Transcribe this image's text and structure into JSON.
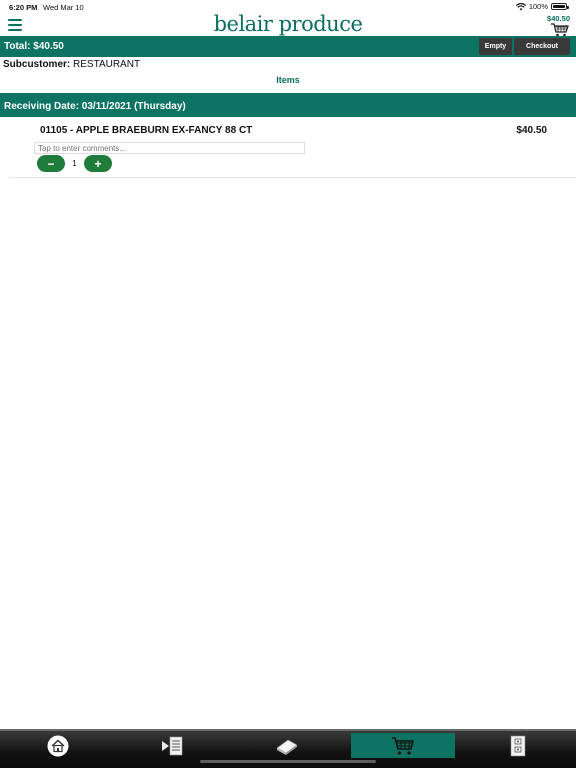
{
  "status_bar": {
    "time": "6:20 PM",
    "date": "Wed Mar 10",
    "battery": "100%"
  },
  "header": {
    "brand": "belair produce",
    "cart_total": "$40.50",
    "cart_icon": "cart-icon",
    "menu_icon": "hamburger-menu-icon"
  },
  "total_bar": {
    "label": "Total:  $40.50",
    "empty_label": "Empty",
    "checkout_label": "Checkout"
  },
  "subcustomer": {
    "label": "Subcustomer:",
    "value": "RESTAURANT"
  },
  "items_tab": "Items",
  "receiving": {
    "label": "Receiving Date: 03/11/2021 (Thursday)"
  },
  "order_items": [
    {
      "title": "01105 - APPLE BRAEBURN EX-FANCY 88 CT",
      "price": "$40.50",
      "comment_placeholder": "Tap to enter comments...",
      "quantity": "1",
      "minus": "−",
      "plus": "+"
    }
  ],
  "tab_bar": {
    "tabs": [
      {
        "icon": "home-icon",
        "active": false
      },
      {
        "icon": "order-list-icon",
        "active": false
      },
      {
        "icon": "catalog-book-icon",
        "active": false
      },
      {
        "icon": "cart-icon",
        "active": true
      },
      {
        "icon": "settings-panel-icon",
        "active": false
      }
    ]
  },
  "colors": {
    "brand_green": "#0d7463",
    "stepper_green": "#1f7c3a",
    "button_dark": "#3a3a3a"
  }
}
